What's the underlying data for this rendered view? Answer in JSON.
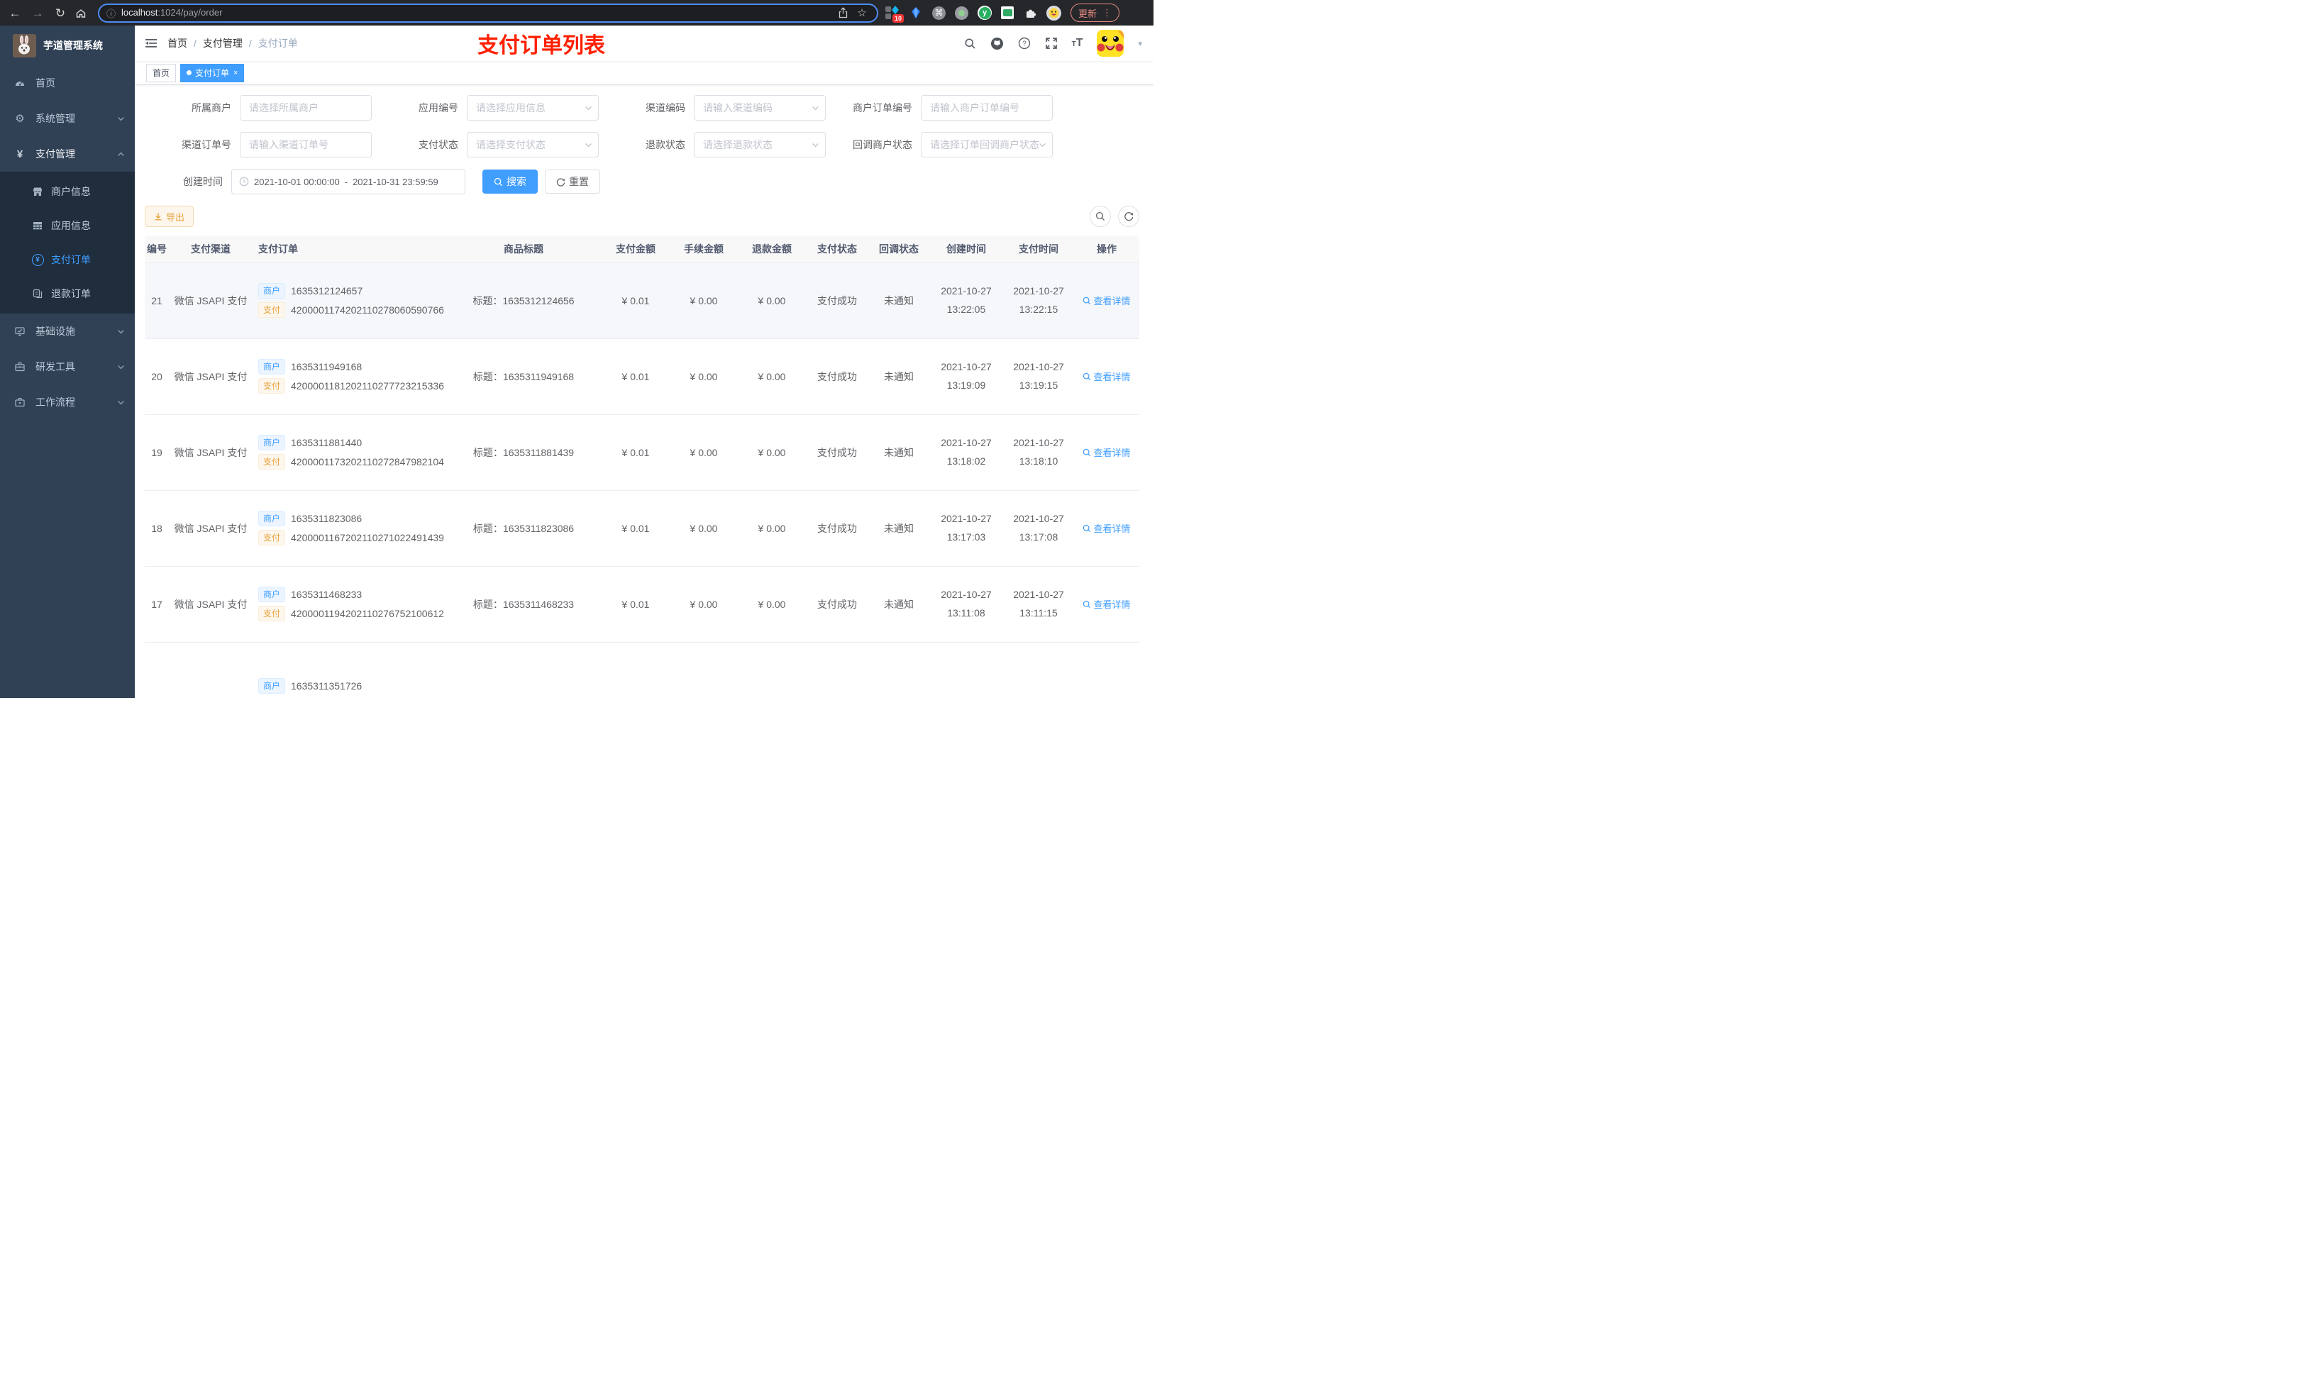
{
  "browser": {
    "url": {
      "host": "localhost",
      "rest": ":1024/pay/order"
    },
    "extensions_badge": "10",
    "update_label": "更新"
  },
  "icons": {
    "yen": "¥",
    "close": "×",
    "caret": "▾",
    "back": "←",
    "forward": "→",
    "reload": "↻",
    "star": "☆",
    "command": "⌘",
    "info": "ⓘ",
    "menu_dots": "⋮",
    "gear": "⚙"
  },
  "colors": {
    "accent": "#409eff",
    "sidebar_bg": "#304156",
    "submenu_bg": "#1f2d3d",
    "warning": "#e6a23c",
    "title_red": "#ff1f00"
  },
  "sidebar": {
    "title": "芋道管理系统",
    "menu": [
      {
        "label": "首页"
      },
      {
        "label": "系统管理"
      },
      {
        "label": "支付管理"
      },
      {
        "label": "基础设施"
      },
      {
        "label": "研发工具"
      },
      {
        "label": "工作流程"
      }
    ],
    "submenu": [
      {
        "label": "商户信息"
      },
      {
        "label": "应用信息"
      },
      {
        "label": "支付订单"
      },
      {
        "label": "退款订单"
      }
    ]
  },
  "navbar": {
    "breadcrumb": {
      "items": [
        "首页",
        "支付管理",
        "支付订单"
      ],
      "separator": "/"
    },
    "title": "支付订单列表"
  },
  "tabs": {
    "home": "首页",
    "current": "支付订单"
  },
  "filters": {
    "fields": [
      {
        "label": "所属商户",
        "placeholder": "请选择所属商户"
      },
      {
        "label": "应用编号",
        "placeholder": "请选择应用信息"
      },
      {
        "label": "渠道编码",
        "placeholder": "请输入渠道编码"
      },
      {
        "label": "商户订单编号",
        "placeholder": "请输入商户订单编号"
      },
      {
        "label": "渠道订单号",
        "placeholder": "请输入渠道订单号"
      },
      {
        "label": "支付状态",
        "placeholder": "请选择支付状态"
      },
      {
        "label": "退款状态",
        "placeholder": "请选择退款状态"
      },
      {
        "label": "回调商户状态",
        "placeholder": "请选择订单回调商户状态"
      }
    ],
    "date": {
      "label": "创建时间",
      "start": "2021-10-01 00:00:00",
      "separator": "-",
      "end": "2021-10-31 23:59:59"
    },
    "search_label": "搜索",
    "reset_label": "重置"
  },
  "toolbar": {
    "export_label": "导出"
  },
  "table": {
    "headers": [
      "编号",
      "支付渠道",
      "支付订单",
      "商品标题",
      "支付金额",
      "手续金额",
      "退款金额",
      "支付状态",
      "回调状态",
      "创建时间",
      "支付时间",
      "操作"
    ],
    "tag_merchant": "商户",
    "tag_pay": "支付",
    "action_label": "查看详情",
    "rows": [
      {
        "id": "21",
        "channel": "微信 JSAPI 支付",
        "merchant_no": "1635312124657",
        "pay_no": "4200001174202110278060590766",
        "title": "标题：1635312124656",
        "amount": "¥ 0.01",
        "fee": "¥ 0.00",
        "refund": "¥ 0.00",
        "status": "支付成功",
        "notify": "未通知",
        "created": "2021-10-27 13:22:05",
        "paid": "2021-10-27 13:22:15"
      },
      {
        "id": "20",
        "channel": "微信 JSAPI 支付",
        "merchant_no": "1635311949168",
        "pay_no": "4200001181202110277723215336",
        "title": "标题：1635311949168",
        "amount": "¥ 0.01",
        "fee": "¥ 0.00",
        "refund": "¥ 0.00",
        "status": "支付成功",
        "notify": "未通知",
        "created": "2021-10-27 13:19:09",
        "paid": "2021-10-27 13:19:15"
      },
      {
        "id": "19",
        "channel": "微信 JSAPI 支付",
        "merchant_no": "1635311881440",
        "pay_no": "4200001173202110272847982104",
        "title": "标题：1635311881439",
        "amount": "¥ 0.01",
        "fee": "¥ 0.00",
        "refund": "¥ 0.00",
        "status": "支付成功",
        "notify": "未通知",
        "created": "2021-10-27 13:18:02",
        "paid": "2021-10-27 13:18:10"
      },
      {
        "id": "18",
        "channel": "微信 JSAPI 支付",
        "merchant_no": "1635311823086",
        "pay_no": "4200001167202110271022491439",
        "title": "标题：1635311823086",
        "amount": "¥ 0.01",
        "fee": "¥ 0.00",
        "refund": "¥ 0.00",
        "status": "支付成功",
        "notify": "未通知",
        "created": "2021-10-27 13:17:03",
        "paid": "2021-10-27 13:17:08"
      },
      {
        "id": "17",
        "channel": "微信 JSAPI 支付",
        "merchant_no": "1635311468233",
        "pay_no": "4200001194202110276752100612",
        "title": "标题：1635311468233",
        "amount": "¥ 0.01",
        "fee": "¥ 0.00",
        "refund": "¥ 0.00",
        "status": "支付成功",
        "notify": "未通知",
        "created": "2021-10-27 13:11:08",
        "paid": "2021-10-27 13:11:15"
      }
    ],
    "partial_row": {
      "merchant_no": "1635311351726"
    }
  }
}
